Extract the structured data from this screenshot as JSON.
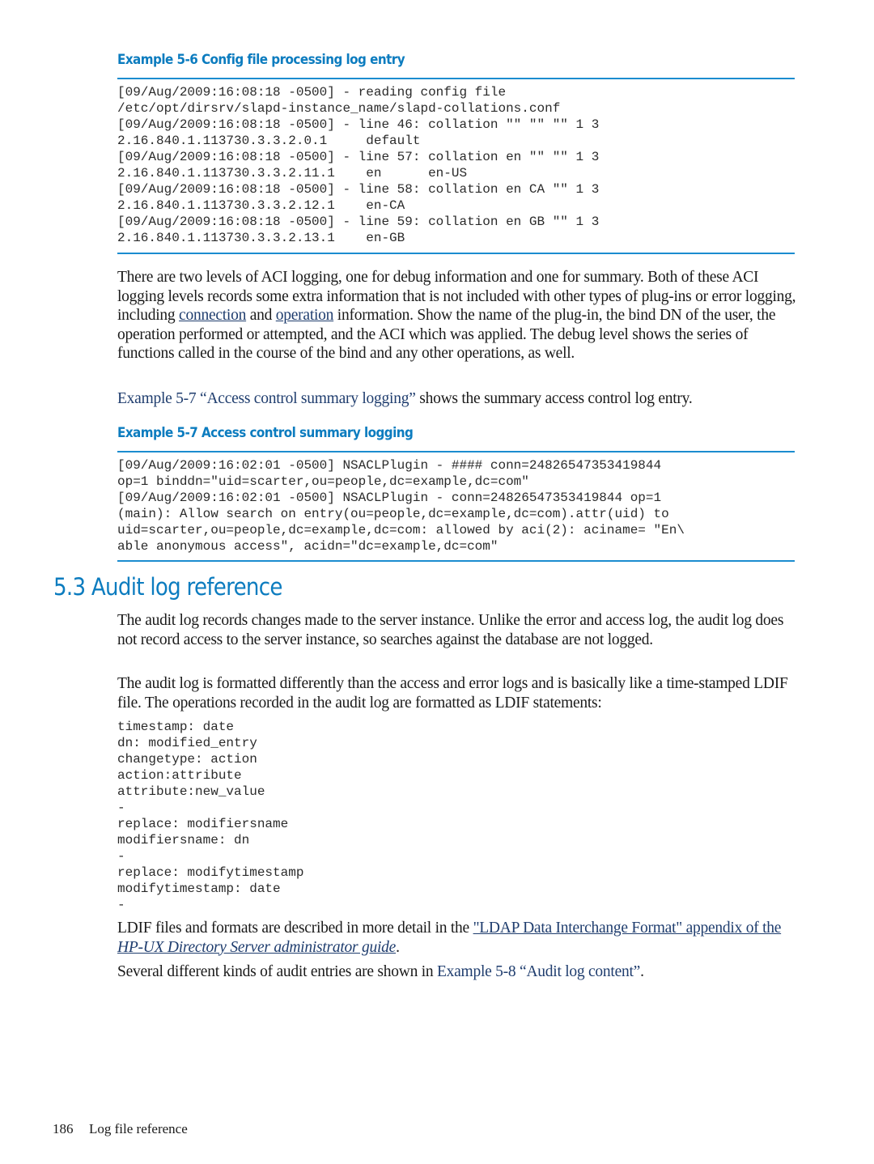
{
  "example_5_6": {
    "title": "Example 5-6 Config file processing log entry",
    "lines": [
      "[09/Aug/2009:16:08:18 -0500] - reading config file",
      "/etc/opt/dirsrv/slapd-instance_name/slapd-collations.conf",
      "[09/Aug/2009:16:08:18 -0500] - line 46: collation \"\" \"\" \"\" 1 3",
      "2.16.840.1.113730.3.3.2.0.1     default",
      "[09/Aug/2009:16:08:18 -0500] - line 57: collation en \"\" \"\" 1 3",
      "2.16.840.1.113730.3.3.2.11.1    en      en-US",
      "[09/Aug/2009:16:08:18 -0500] - line 58: collation en CA \"\" 1 3",
      "2.16.840.1.113730.3.3.2.12.1    en-CA",
      "[09/Aug/2009:16:08:18 -0500] - line 59: collation en GB \"\" 1 3",
      "2.16.840.1.113730.3.3.2.13.1    en-GB"
    ]
  },
  "aci_paragraph": {
    "text_1": "There are two levels of ACI logging, one for debug information and one for summary. Both of these ACI logging levels records some extra information that is not included with other types of plug-ins or error logging, including ",
    "link_connection": "connection",
    "text_2": " and ",
    "link_operation": "operation",
    "text_3": " information. Show the name of the plug-in, the bind DN of the user, the operation performed or attempted, and the ACI which was applied. The debug level shows the series of functions called in the course of the bind and any other operations, as well."
  },
  "xref_5_7_paragraph": {
    "xref": "Example 5-7 “Access control summary logging”",
    "text": " shows the summary access control log entry."
  },
  "example_5_7": {
    "title": "Example 5-7 Access control summary logging",
    "lines": [
      "[09/Aug/2009:16:02:01 -0500] NSACLPlugin - #### conn=24826547353419844",
      "op=1 binddn=\"uid=scarter,ou=people,dc=example,dc=com\"",
      "[09/Aug/2009:16:02:01 -0500] NSACLPlugin - conn=24826547353419844 op=1",
      "(main): Allow search on entry(ou=people,dc=example,dc=com).attr(uid) to",
      "uid=scarter,ou=people,dc=example,dc=com: allowed by aci(2): aciname= \"En\\",
      "able anonymous access\", acidn=\"dc=example,dc=com\""
    ]
  },
  "section_5_3": {
    "title": "5.3 Audit log reference",
    "para_1": "The audit log records changes made to the server instance. Unlike the error and access log, the audit log does not record access to the server instance, so searches against the database are not logged.",
    "para_2": "The audit log is formatted differently than the access and error logs and is basically like a time-stamped LDIF file. The operations recorded in the audit log are formatted as LDIF statements:",
    "ldif_lines": [
      "timestamp: date",
      "dn: modified_entry",
      "changetype: action",
      "action:attribute",
      "attribute:new_value",
      "-",
      "replace: modifiersname",
      "modifiersname: dn",
      "-",
      "replace: modifytimestamp",
      "modifytimestamp: date",
      "-"
    ],
    "para_3": {
      "text_1": "LDIF files and formats are described in more detail in the ",
      "link_1": "\"LDAP Data Interchange Format\" appendix of the ",
      "link_italic": "HP-UX Directory Server administrator guide",
      "text_2": "."
    },
    "para_4": {
      "text": "Several different kinds of audit entries are shown in ",
      "xref": "Example 5-8 “Audit log content”",
      "end": "."
    }
  },
  "footer": {
    "page_number": "186",
    "section": "Log file reference"
  }
}
